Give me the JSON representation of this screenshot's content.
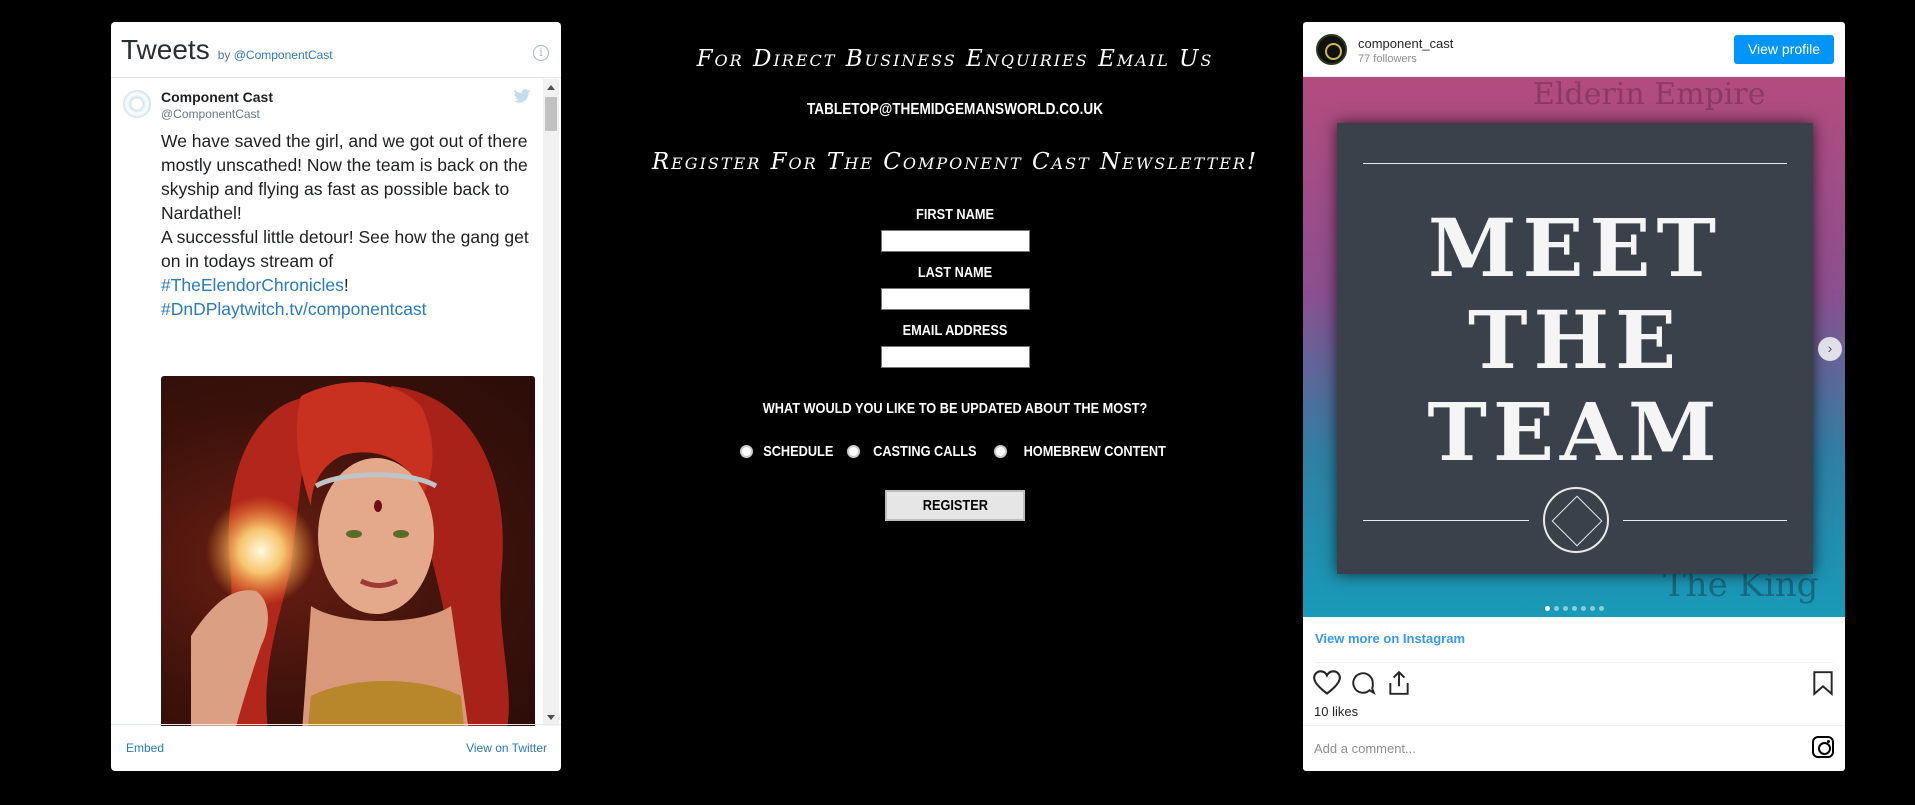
{
  "twitter": {
    "title": "Tweets",
    "by_prefix": "by",
    "by_handle": "@ComponentCast",
    "info_glyph": "i",
    "tweet": {
      "author_name": "Component Cast",
      "author_handle": "@ComponentCast",
      "text_line1": "We have saved the girl, and we got out of there mostly unscathed! Now the team is back on the skyship and flying as fast as possible back to Nardathel!",
      "text_line2": "A successful little detour! See how the gang get on in todays stream of",
      "hashtag1": "#TheElendorChronicles",
      "hashtag1_suffix": "!",
      "link2": "#DnDPlaytwitch.tv/componentcast"
    },
    "embed_label": "Embed",
    "view_label": "View on Twitter",
    "link_color": "#2b7bb9"
  },
  "center": {
    "heading1": "For Direct Business Enquiries Email Us",
    "email": "TABLETOP@THEMIDGEMANSWORLD.CO.UK",
    "heading2": "Register For The Component Cast Newsletter!",
    "first_name_label": "FIRST NAME",
    "first_name_value": "",
    "last_name_label": "LAST NAME",
    "last_name_value": "",
    "email_label": "EMAIL ADDRESS",
    "email_value": "",
    "question": "WHAT WOULD YOU LIKE TO BE UPDATED ABOUT THE MOST?",
    "options": [
      "SCHEDULE",
      "CASTING CALLS",
      "HOMEBREW CONTENT"
    ],
    "register_label": "REGISTER"
  },
  "instagram": {
    "username": "component_cast",
    "followers": "77 followers",
    "view_profile_label": "View profile",
    "photo_text": [
      "MEET",
      "THE",
      "TEAM"
    ],
    "map_text_top": "Elderin Empire",
    "map_text_bottom": "The King",
    "view_more_label": "View more on Instagram",
    "likes": "10 likes",
    "comment_placeholder": "Add a comment...",
    "carousel_dots": 7,
    "carousel_active": 1,
    "button_color": "#0095f6"
  }
}
